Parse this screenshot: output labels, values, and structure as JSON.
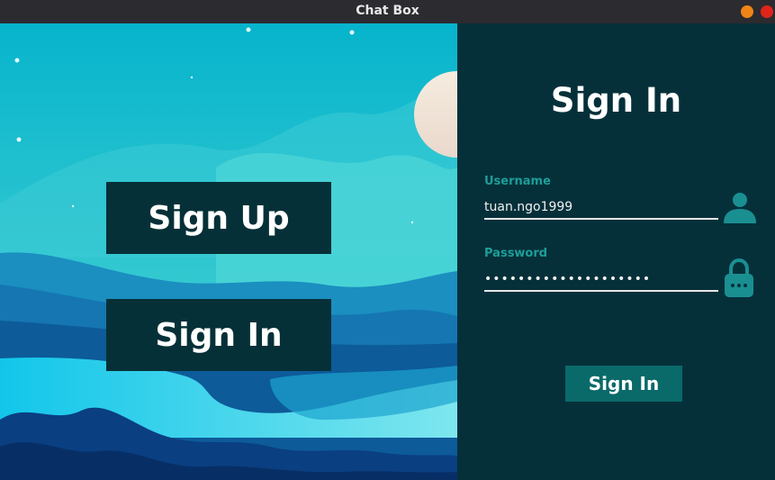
{
  "window": {
    "title": "Chat Box",
    "controls": [
      "minimize",
      "close"
    ],
    "colors": {
      "titlebar": "#2c2b2f",
      "minimize": "#f08417",
      "close": "#e0241b"
    }
  },
  "left_panel": {
    "background": "teal mountain landscape illustration with moon and stars",
    "buttons": {
      "sign_up": "Sign Up",
      "sign_in": "Sign In"
    }
  },
  "form": {
    "title": "Sign In",
    "username": {
      "label": "Username",
      "value": "tuan.ngo1999",
      "icon": "user-icon"
    },
    "password": {
      "label": "Password",
      "value": "••••••••••••••••••••",
      "icon": "lock-icon"
    },
    "submit_label": "Sign In"
  },
  "colors": {
    "panel_bg": "#05303a",
    "accent": "#1e9e98",
    "button_dark": "#063038",
    "submit_bg": "#0a6a6a"
  }
}
